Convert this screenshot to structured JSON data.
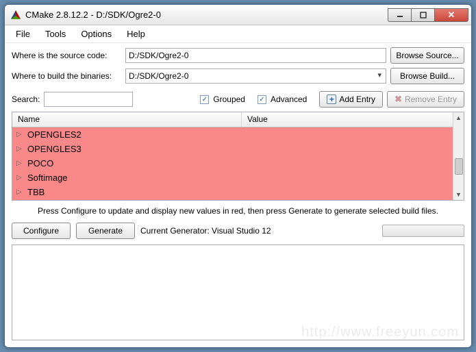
{
  "window": {
    "title": "CMake 2.8.12.2 - D:/SDK/Ogre2-0"
  },
  "menu": {
    "file": "File",
    "tools": "Tools",
    "options": "Options",
    "help": "Help"
  },
  "source": {
    "label": "Where is the source code:",
    "value": "D:/SDK/Ogre2-0",
    "browse": "Browse Source..."
  },
  "build": {
    "label": "Where to build the binaries:",
    "value": "D:/SDK/Ogre2-0",
    "browse": "Browse Build..."
  },
  "search": {
    "label": "Search:",
    "value": ""
  },
  "checks": {
    "grouped": "Grouped",
    "advanced": "Advanced"
  },
  "buttons": {
    "addEntry": "Add Entry",
    "removeEntry": "Remove Entry"
  },
  "tree": {
    "cols": {
      "name": "Name",
      "value": "Value"
    },
    "items": [
      {
        "label": "OPENGLES2"
      },
      {
        "label": "OPENGLES3"
      },
      {
        "label": "POCO"
      },
      {
        "label": "Softimage"
      },
      {
        "label": "TBB"
      }
    ]
  },
  "hint": "Press Configure to update and display new values in red, then press Generate to generate selected build files.",
  "gen": {
    "configure": "Configure",
    "generate": "Generate",
    "currentLabel": "Current Generator: Visual Studio 12"
  },
  "watermark": "http://www.freeyun.com"
}
